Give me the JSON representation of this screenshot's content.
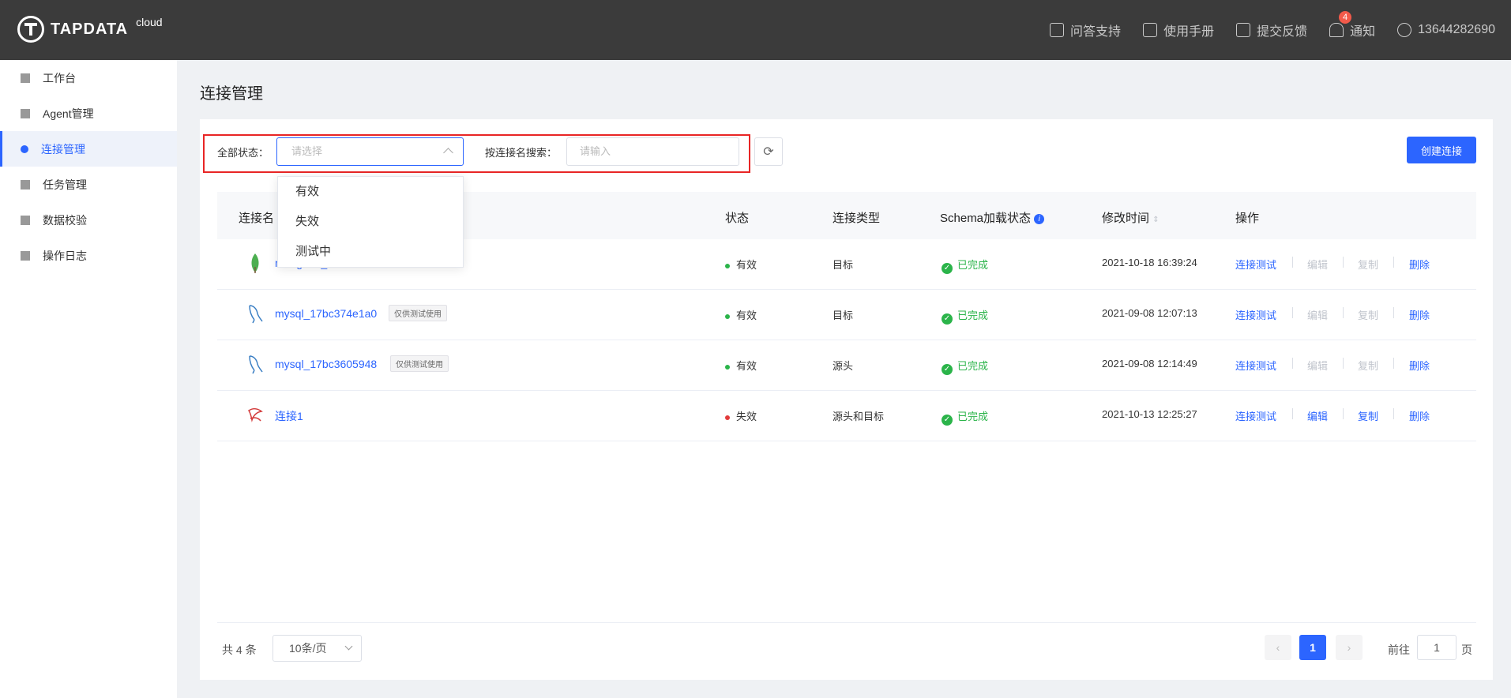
{
  "header": {
    "logo_text": "TAPDATA",
    "logo_sup": "cloud",
    "nav": [
      {
        "label": "问答支持",
        "icon": "help-icon"
      },
      {
        "label": "使用手册",
        "icon": "paper-plane-icon"
      },
      {
        "label": "提交反馈",
        "icon": "feedback-icon"
      },
      {
        "label": "通知",
        "icon": "bell-icon",
        "badge": "4"
      },
      {
        "label": "13644282690",
        "icon": "user-icon"
      }
    ]
  },
  "sidebar": {
    "items": [
      {
        "label": "工作台",
        "icon": "dashboard-icon"
      },
      {
        "label": "Agent管理",
        "icon": "agent-icon"
      },
      {
        "label": "连接管理",
        "icon": "connection-icon",
        "active": true
      },
      {
        "label": "任务管理",
        "icon": "task-icon"
      },
      {
        "label": "数据校验",
        "icon": "check-icon"
      },
      {
        "label": "操作日志",
        "icon": "log-icon"
      }
    ]
  },
  "main": {
    "title": "连接管理",
    "filters": {
      "status_label": "全部状态：",
      "status_placeholder": "请选择",
      "search_label": "按连接名搜索：",
      "search_placeholder": "请输入"
    },
    "create_button": "创建连接",
    "dropdown_options": [
      "有效",
      "失效",
      "测试中"
    ],
    "table": {
      "headers": {
        "name": "连接名",
        "status": "状态",
        "type": "连接类型",
        "schema": "Schema加载状态",
        "modified": "修改时间",
        "ops": "操作"
      },
      "rows": [
        {
          "name": "mongodb_17bc37565ff",
          "tag": "",
          "db": "mongodb",
          "status": "有效",
          "status_color": "green",
          "type": "目标",
          "schema": "已完成",
          "modified": "2021-10-18 16:39:24",
          "edit_enabled": false
        },
        {
          "name": "mysql_17bc374e1a0",
          "tag": "仅供测试使用",
          "db": "mysql",
          "status": "有效",
          "status_color": "green",
          "type": "目标",
          "schema": "已完成",
          "modified": "2021-09-08 12:07:13",
          "edit_enabled": false
        },
        {
          "name": "mysql_17bc3605948",
          "tag": "仅供测试使用",
          "db": "mysql",
          "status": "有效",
          "status_color": "green",
          "type": "源头",
          "schema": "已完成",
          "modified": "2021-09-08 12:14:49",
          "edit_enabled": false
        },
        {
          "name": "连接1",
          "tag": "",
          "db": "sqlserver",
          "status": "失效",
          "status_color": "red",
          "type": "源头和目标",
          "schema": "已完成",
          "modified": "2021-10-13 12:25:27",
          "edit_enabled": true
        }
      ],
      "ops": {
        "test": "连接测试",
        "edit": "编辑",
        "copy": "复制",
        "delete": "删除"
      }
    },
    "pagination": {
      "total": "共 4 条",
      "page_size": "10条/页",
      "current_page": "1",
      "goto_label": "前往",
      "goto_value": "1",
      "goto_suffix": "页",
      "prev": "‹",
      "next": "›"
    }
  },
  "colors": {
    "accent": "#2c65ff",
    "header_bg": "#3b3b3b",
    "success": "#2bb44a",
    "danger": "#e23b3b",
    "highlight_border": "#e82525"
  }
}
